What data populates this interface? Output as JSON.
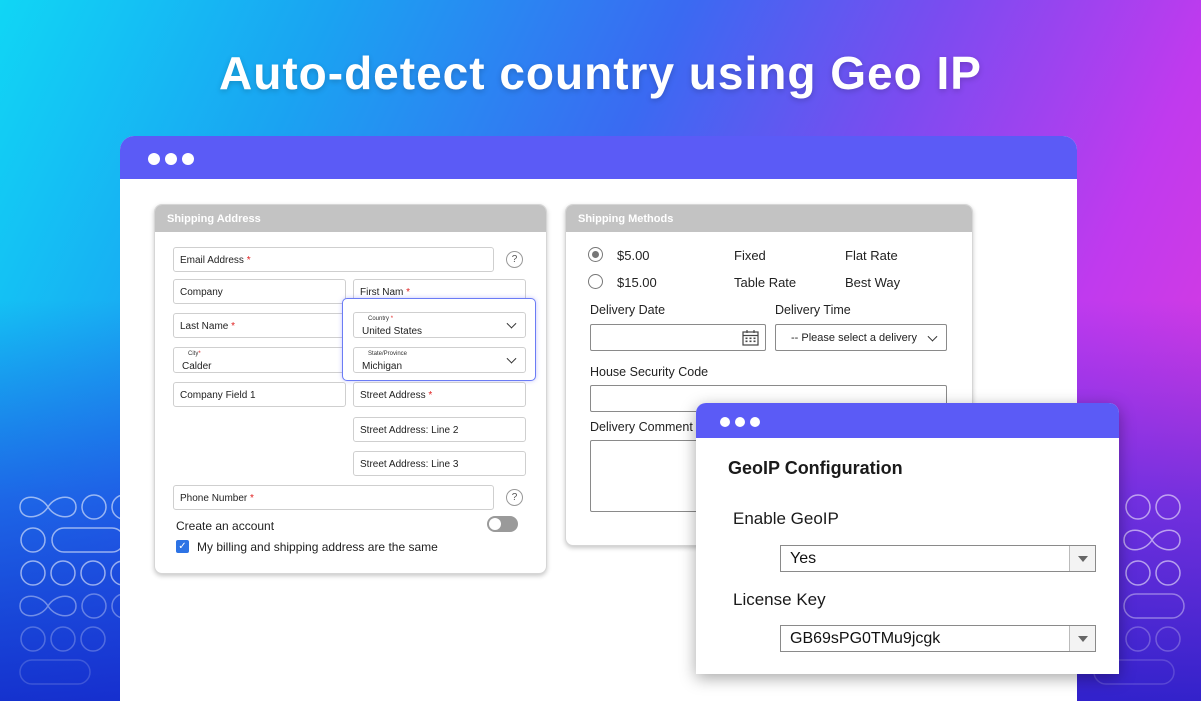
{
  "headline": "Auto-detect country using Geo IP",
  "shipping_address": {
    "header": "Shipping Address",
    "email_label": "Email Address",
    "company_label": "Company",
    "first_name_label": "First Nam",
    "last_name_label": "Last Name",
    "country": {
      "label": "Country",
      "value": "United States"
    },
    "state": {
      "label": "State/Province",
      "value": "Michigan"
    },
    "city": {
      "label": "City",
      "value": "Calder"
    },
    "company_field_label": "Company Field 1",
    "street_label": "Street Address",
    "street_line2_label": "Street Address: Line 2",
    "street_line3_label": "Street Address: Line 3",
    "phone_label": "Phone Number",
    "required_mark": "*",
    "help_mark": "?",
    "create_account_label": "Create an account",
    "same_address_label": "My billing and shipping address are the same"
  },
  "shipping_methods": {
    "header": "Shipping Methods",
    "options": [
      {
        "price": "$5.00",
        "method": "Fixed",
        "carrier": "Flat Rate",
        "selected": true
      },
      {
        "price": "$15.00",
        "method": "Table Rate",
        "carrier": "Best Way",
        "selected": false
      }
    ],
    "delivery_date_label": "Delivery Date",
    "delivery_time_label": "Delivery Time",
    "delivery_time_placeholder": "-- Please select a delivery",
    "security_code_label": "House Security Code",
    "comment_label": "Delivery Comment"
  },
  "geoip": {
    "title": "GeoIP Configuration",
    "enable_label": "Enable GeoIP",
    "enable_value": "Yes",
    "license_label": "License Key",
    "license_value": "GB69sPG0TMu9jcgk"
  },
  "colors": {
    "accent": "#5b5bf6",
    "required": "#e02020",
    "checkbox": "#2d73e5"
  }
}
